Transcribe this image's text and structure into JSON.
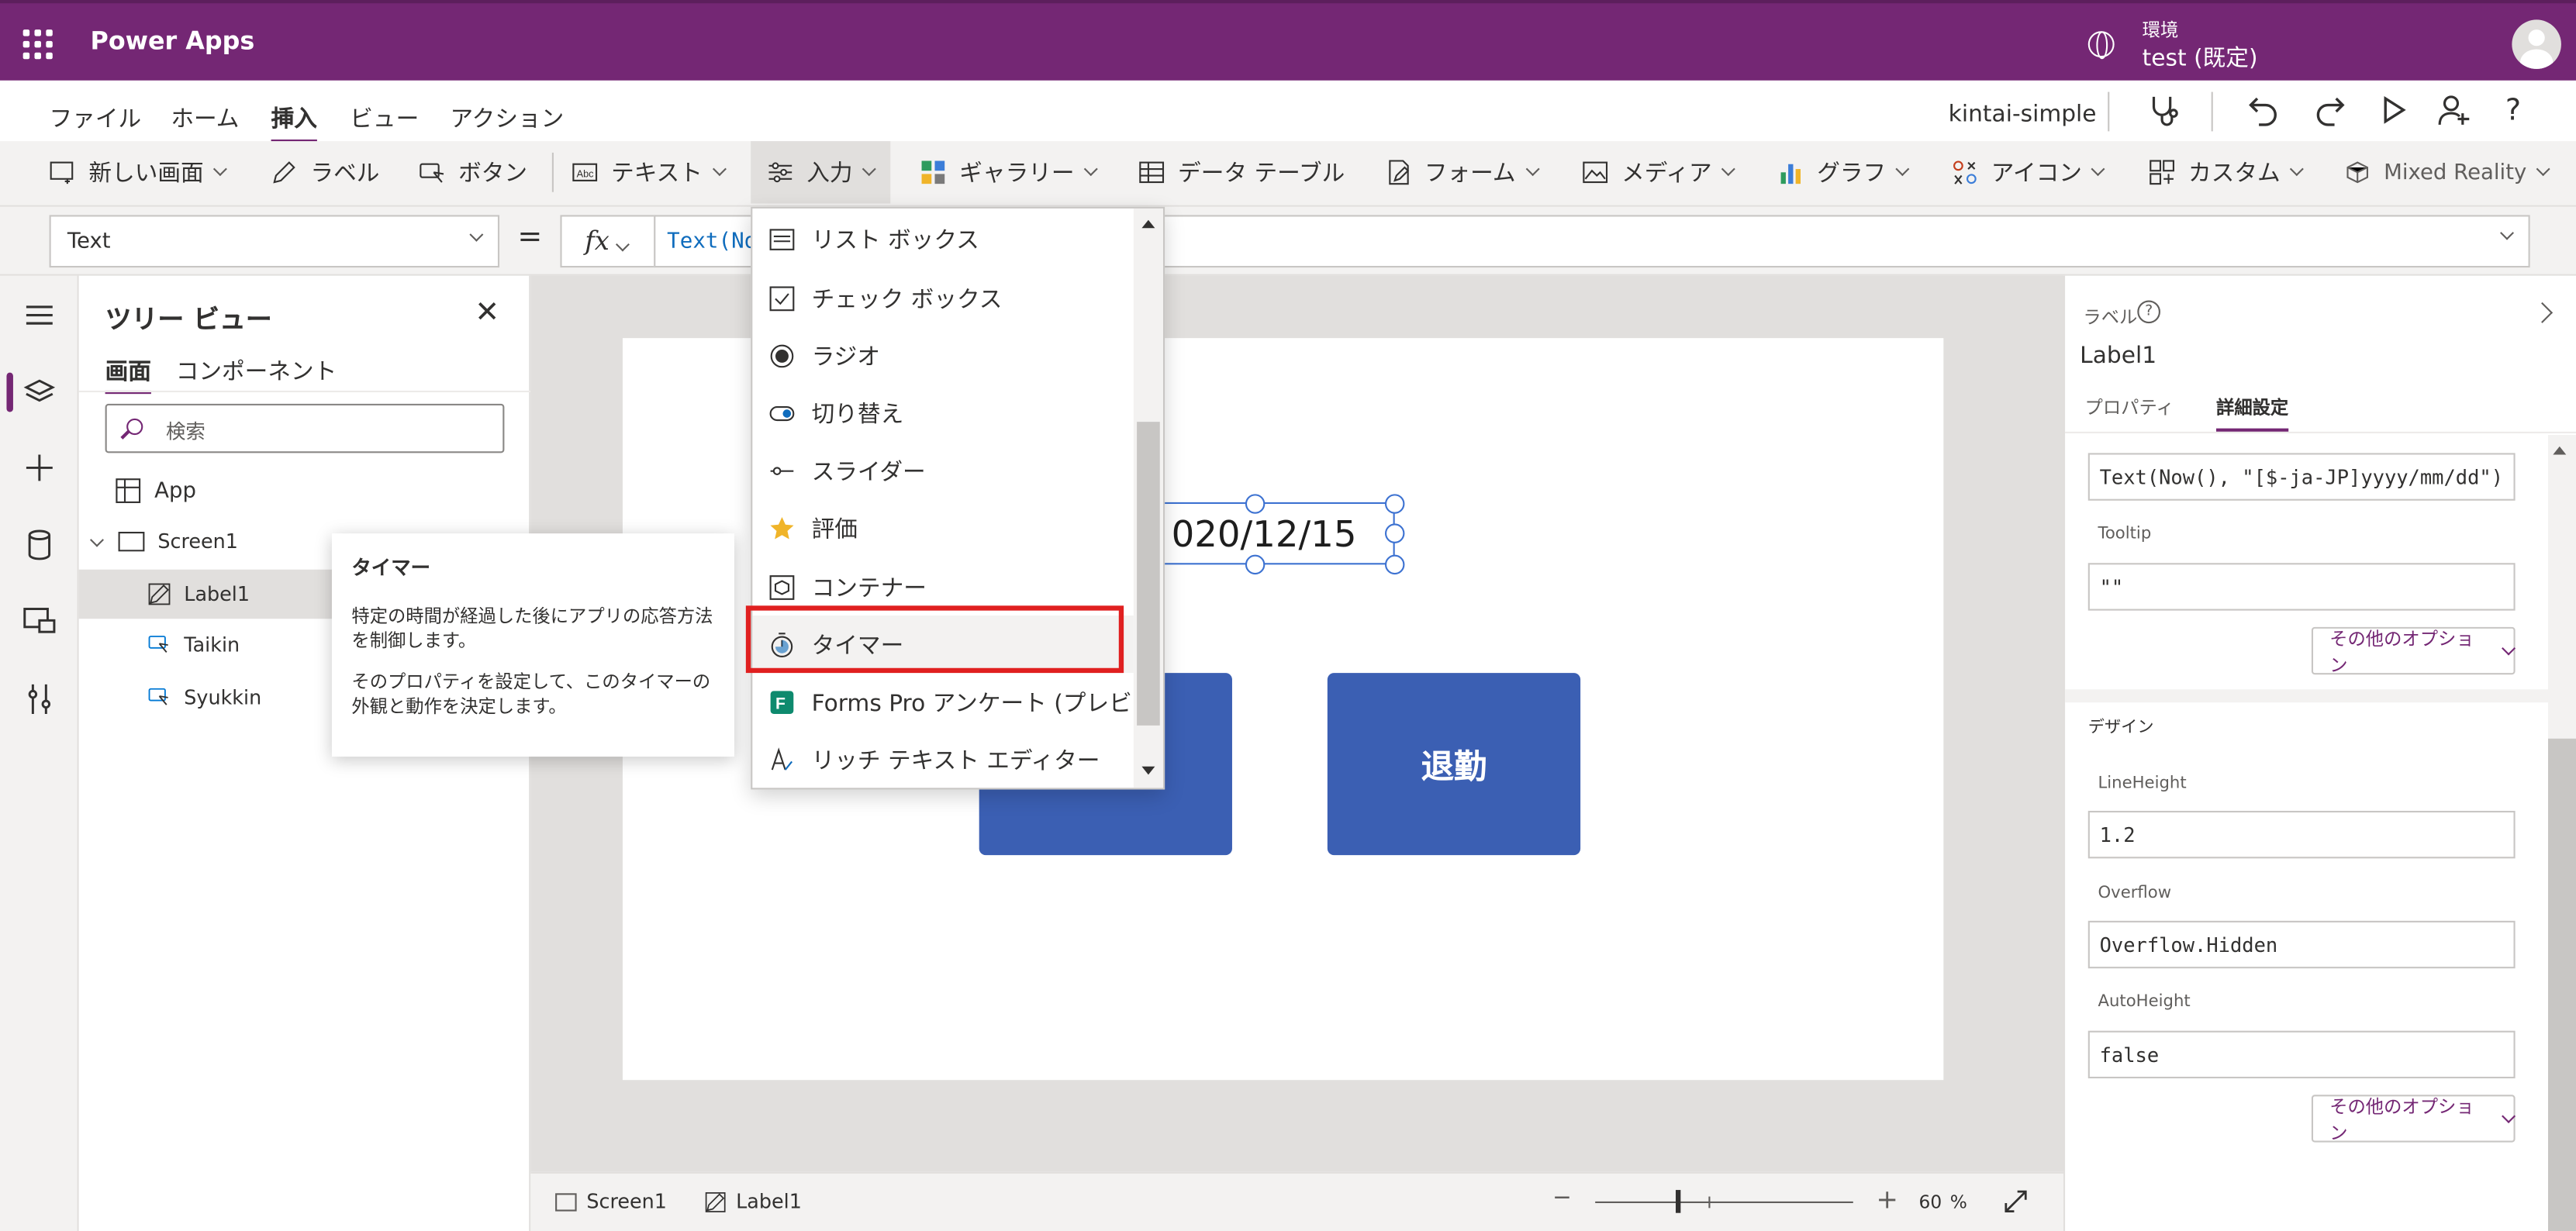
{
  "header": {
    "brand": "Power Apps",
    "env_label": "環境",
    "env_name": "test (既定)"
  },
  "menu": {
    "items": [
      "ファイル",
      "ホーム",
      "挿入",
      "ビュー",
      "アクション"
    ],
    "active": "挿入",
    "app_name": "kintai-simple"
  },
  "ribbon": {
    "new_screen": "新しい画面",
    "label": "ラベル",
    "button": "ボタン",
    "text": "テキスト",
    "input": "入力",
    "gallery": "ギャラリー",
    "data_table": "データ テーブル",
    "form": "フォーム",
    "media": "メディア",
    "chart": "グラフ",
    "icons": "アイコン",
    "custom": "カスタム",
    "mixed_reality": "Mixed Reality"
  },
  "formula_bar": {
    "property": "Text",
    "equals": "=",
    "fx": "fx",
    "formula": "Text(No"
  },
  "tree": {
    "title": "ツリー ビュー",
    "tabs": [
      "画面",
      "コンポーネント"
    ],
    "search_placeholder": "検索",
    "items": [
      {
        "label": "App"
      },
      {
        "label": "Screen1"
      },
      {
        "label": "Label1"
      },
      {
        "label": "Taikin"
      },
      {
        "label": "Syukkin"
      }
    ]
  },
  "tooltip": {
    "title": "タイマー",
    "body1": "特定の時間が経過した後にアプリの応答方法を制御します。",
    "body2": "そのプロパティを設定して、このタイマーの外観と動作を決定します。"
  },
  "dropdown": {
    "items": [
      {
        "label": "リスト ボックス",
        "icon": "list-box-icon"
      },
      {
        "label": "チェック ボックス",
        "icon": "checkbox-icon"
      },
      {
        "label": "ラジオ",
        "icon": "radio-icon"
      },
      {
        "label": "切り替え",
        "icon": "toggle-icon"
      },
      {
        "label": "スライダー",
        "icon": "slider-icon"
      },
      {
        "label": "評価",
        "icon": "star-icon"
      },
      {
        "label": "コンテナー",
        "icon": "container-icon"
      },
      {
        "label": "タイマー",
        "icon": "timer-icon"
      },
      {
        "label": "Forms Pro アンケート (プレビ",
        "icon": "forms-icon"
      },
      {
        "label": "リッチ テキスト エディター",
        "icon": "rich-text-icon"
      }
    ],
    "highlighted": "タイマー"
  },
  "canvas": {
    "label_text": "020/12/15",
    "taikin_button": "退勤"
  },
  "status_bar": {
    "screen": "Screen1",
    "control": "Label1",
    "zoom": "60",
    "zoom_unit": "%",
    "minus": "−",
    "plus": "+"
  },
  "properties": {
    "type": "ラベル",
    "name": "Label1",
    "tabs": [
      "プロパティ",
      "詳細設定"
    ],
    "text_value": "Text(Now(), \"[$-ja-JP]yyyy/mm/dd\")",
    "tooltip_label": "Tooltip",
    "tooltip_value": "\"\"",
    "more_options": "その他のオプション",
    "design_header": "デザイン",
    "lineheight_label": "LineHeight",
    "lineheight_value": "1.2",
    "overflow_label": "Overflow",
    "overflow_value": "Overflow.Hidden",
    "autoheight_label": "AutoHeight",
    "autoheight_value": "false"
  },
  "colors": {
    "brand": "#742774",
    "button": "#3b5fb3",
    "highlight": "#e02020"
  }
}
